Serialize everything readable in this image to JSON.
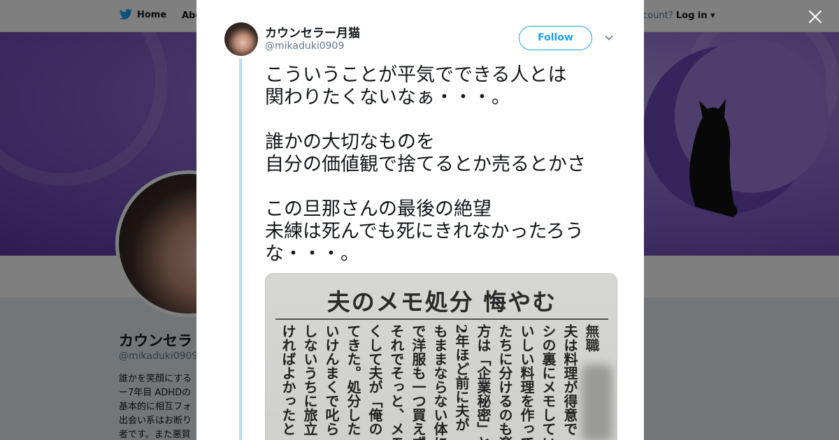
{
  "nav": {
    "home_label": "Home",
    "about_label": "Abo",
    "account_prompt": "ccount?",
    "login_label": "Log in"
  },
  "profile_bg": {
    "name": "カウンセラ",
    "handle": "@mikaduki0909",
    "bio_lines": [
      "誰かを笑顔にする",
      "ー7年目 ADHDの",
      "基本的に相互フォ",
      "出会い系はお断り",
      "者です。また悪質"
    ]
  },
  "tweet": {
    "author_name": "カウンセラー月猫",
    "author_handle": "@mikaduki0909",
    "follow_label": "Follow",
    "text": "こういうことが平気でできる人とは\n関わりたくないなぁ・・・。\n\n誰かの大切なものを\n自分の価値観で捨てるとか売るとかさ\n\nこの旦那さんの最後の絶望\n未練は死んでも死にきれなかったろう\nな・・・。"
  },
  "clipping": {
    "headline": "夫のメモ処分 悔やむ",
    "columns": [
      "無職",
      "夫は料理が得意で",
      "シの裏にメモしてい",
      "いしい料理を作って",
      "たちに分けるのも楽",
      "方は「企業秘密」と",
      "2年ほど前に夫が",
      "もままならない体に",
      "で洋服も一つ買えず",
      "それでそっと、メモ",
      "くして夫が「俺の",
      "てきた。処分した",
      "いけんまくで叱ら",
      "しないうちに旅立",
      "ければよかったと"
    ]
  },
  "colors": {
    "twitter_blue": "#1da1f2",
    "thread_line": "#b7dcf5",
    "banner_purple": "#8a6ad0"
  }
}
